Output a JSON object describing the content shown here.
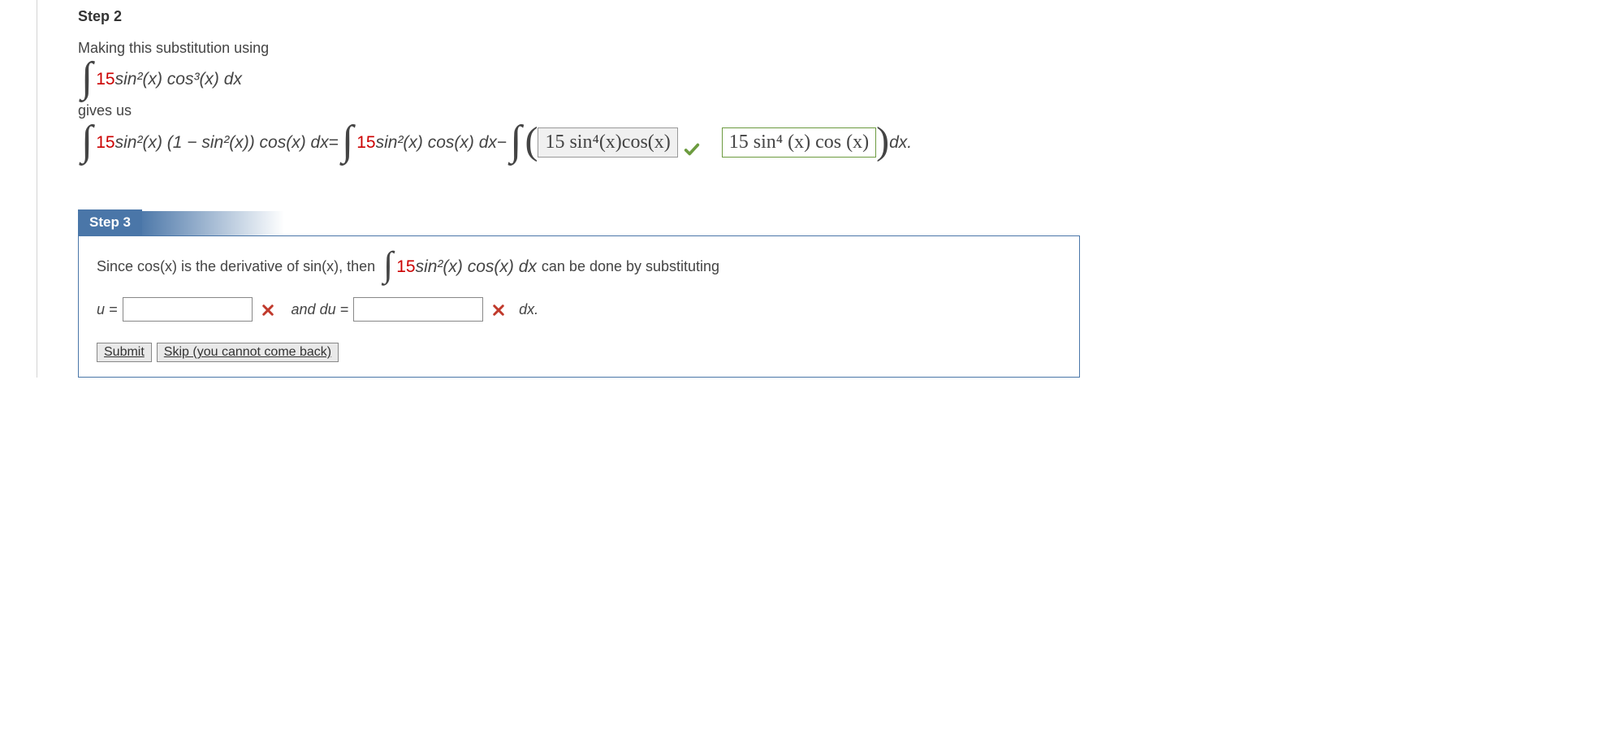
{
  "step2": {
    "heading": "Step 2",
    "line1": "Making this substitution using",
    "coef": "15",
    "sin2cos3": " sin²(x) cos³(x) dx",
    "gives": "gives us",
    "lhs_after_coef": " sin²(x) (1 − sin²(x)) cos(x) dx",
    "eq": " = ",
    "rhs1_after_coef": " sin²(x) cos(x) dx",
    "minus": " − ",
    "user_answer": "15 sin⁴(x)cos(x)",
    "correct_answer": "15 sin⁴ (x) cos (x)",
    "dx_end": " dx."
  },
  "step3": {
    "heading": "Step 3",
    "before": "Since  cos(x)  is the derivative of  sin(x),  then ",
    "after_integral": " sin²(x) cos(x) dx ",
    "after2": " can be done by substituting",
    "u_label": "u = ",
    "and_du": " and  du = ",
    "dx_end": " dx.",
    "submit": "Submit",
    "skip": "Skip (you cannot come back)"
  }
}
